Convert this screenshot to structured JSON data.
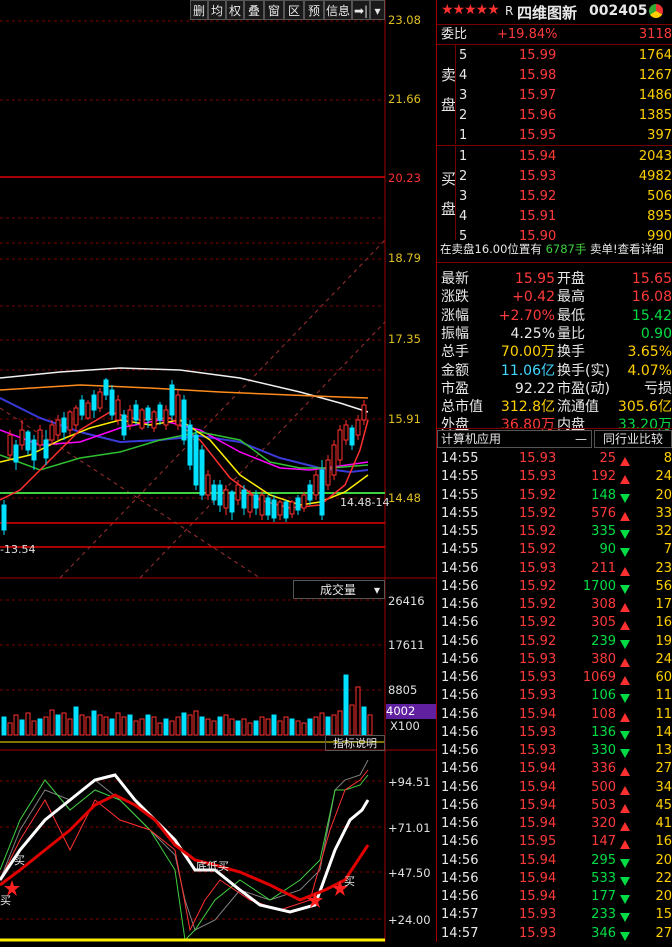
{
  "toolbar": {
    "buttons": [
      "删",
      "均",
      "权",
      "叠",
      "窗",
      "区",
      "预",
      "信息",
      "➡|",
      "▾"
    ]
  },
  "price_axis": [
    "23.08",
    "21.66",
    "20.23",
    "18.79",
    "17.35",
    "15.91",
    "14.48"
  ],
  "low_label": "13.54",
  "low_marker": "14.48-14",
  "volume": {
    "label": "成交量",
    "axis": [
      "26416",
      "17611",
      "8805"
    ],
    "current": "4002",
    "unit": "X100"
  },
  "indicator": {
    "label": "指标说明",
    "axis": [
      "+94.51",
      "+71.01",
      "+47.50",
      "+24.00"
    ],
    "annotations": [
      "买",
      "买",
      "底低买",
      "买"
    ]
  },
  "stock": {
    "rating_stars": 5,
    "prefix": "R",
    "name": "四维图新",
    "code": "002405"
  },
  "order_book": {
    "commission_ratio_label": "委比",
    "commission_ratio": "+19.84%",
    "commission_diff": "3118",
    "sell_label": [
      "卖",
      "盘"
    ],
    "buy_label": [
      "买",
      "盘"
    ],
    "sells": [
      {
        "level": "5",
        "price": "15.99",
        "vol": "1764"
      },
      {
        "level": "4",
        "price": "15.98",
        "vol": "1267"
      },
      {
        "level": "3",
        "price": "15.97",
        "vol": "1486"
      },
      {
        "level": "2",
        "price": "15.96",
        "vol": "1385"
      },
      {
        "level": "1",
        "price": "15.95",
        "vol": "397"
      }
    ],
    "buys": [
      {
        "level": "1",
        "price": "15.94",
        "vol": "2043"
      },
      {
        "level": "2",
        "price": "15.93",
        "vol": "4982"
      },
      {
        "level": "3",
        "price": "15.92",
        "vol": "506"
      },
      {
        "level": "4",
        "price": "15.91",
        "vol": "895"
      },
      {
        "level": "5",
        "price": "15.90",
        "vol": "990"
      }
    ],
    "notice_prefix": "在卖盘16.00位置有",
    "notice_vol": "6787手",
    "notice_suffix": "卖单!查看详细"
  },
  "quote": [
    {
      "l1": "最新",
      "v1": "15.95",
      "l2": "开盘",
      "v2": "15.65",
      "c1": "red",
      "c2": "red"
    },
    {
      "l1": "涨跌",
      "v1": "+0.42",
      "l2": "最高",
      "v2": "16.08",
      "c1": "red",
      "c2": "red"
    },
    {
      "l1": "涨幅",
      "v1": "+2.70%",
      "l2": "最低",
      "v2": "15.42",
      "c1": "red",
      "c2": "grn"
    },
    {
      "l1": "振幅",
      "v1": "4.25%",
      "l2": "量比",
      "v2": "0.90",
      "c1": "wht",
      "c2": "grn"
    },
    {
      "l1": "总手",
      "v1": "70.00万",
      "l2": "换手",
      "v2": "3.65%",
      "c1": "yel",
      "c2": "yel"
    },
    {
      "l1": "金额",
      "v1": "11.06亿",
      "l2": "换手(实)",
      "v2": "4.07%",
      "c1": "cyn",
      "c2": "yel"
    },
    {
      "l1": "市盈",
      "v1": "92.22",
      "l2": "市盈(动)",
      "v2": "亏损",
      "c1": "wht",
      "c2": "wht"
    },
    {
      "l1": "总市值",
      "v1": "312.8亿",
      "l2": "流通值",
      "v2": "305.6亿",
      "c1": "yel",
      "c2": "yel"
    },
    {
      "l1": "外盘",
      "v1": "36.80万",
      "l2": "内盘",
      "v2": "33.20万",
      "c1": "red",
      "c2": "grn"
    }
  ],
  "tabs": {
    "left": "计算机应用",
    "left_icon": "—",
    "right": "同行业比较"
  },
  "ticks": [
    {
      "time": "14:55",
      "price": "15.93",
      "vol": "25",
      "dir": "up",
      "extra": "8"
    },
    {
      "time": "14:55",
      "price": "15.93",
      "vol": "192",
      "dir": "up",
      "extra": "24"
    },
    {
      "time": "14:55",
      "price": "15.92",
      "vol": "148",
      "dir": "dn",
      "extra": "20"
    },
    {
      "time": "14:55",
      "price": "15.92",
      "vol": "576",
      "dir": "up",
      "extra": "33"
    },
    {
      "time": "14:55",
      "price": "15.92",
      "vol": "335",
      "dir": "dn",
      "extra": "32"
    },
    {
      "time": "14:55",
      "price": "15.92",
      "vol": "90",
      "dir": "dn",
      "extra": "7"
    },
    {
      "time": "14:56",
      "price": "15.93",
      "vol": "211",
      "dir": "up",
      "extra": "23"
    },
    {
      "time": "14:56",
      "price": "15.92",
      "vol": "1700",
      "dir": "dn",
      "extra": "56"
    },
    {
      "time": "14:56",
      "price": "15.92",
      "vol": "308",
      "dir": "up",
      "extra": "17"
    },
    {
      "time": "14:56",
      "price": "15.92",
      "vol": "305",
      "dir": "up",
      "extra": "16"
    },
    {
      "time": "14:56",
      "price": "15.92",
      "vol": "239",
      "dir": "dn",
      "extra": "19"
    },
    {
      "time": "14:56",
      "price": "15.93",
      "vol": "380",
      "dir": "up",
      "extra": "24"
    },
    {
      "time": "14:56",
      "price": "15.93",
      "vol": "1069",
      "dir": "up",
      "extra": "60"
    },
    {
      "time": "14:56",
      "price": "15.93",
      "vol": "106",
      "dir": "dn",
      "extra": "11"
    },
    {
      "time": "14:56",
      "price": "15.94",
      "vol": "108",
      "dir": "up",
      "extra": "11"
    },
    {
      "time": "14:56",
      "price": "15.93",
      "vol": "136",
      "dir": "dn",
      "extra": "14"
    },
    {
      "time": "14:56",
      "price": "15.93",
      "vol": "330",
      "dir": "dn",
      "extra": "13"
    },
    {
      "time": "14:56",
      "price": "15.94",
      "vol": "336",
      "dir": "up",
      "extra": "27"
    },
    {
      "time": "14:56",
      "price": "15.94",
      "vol": "500",
      "dir": "up",
      "extra": "34"
    },
    {
      "time": "14:56",
      "price": "15.94",
      "vol": "503",
      "dir": "up",
      "extra": "45"
    },
    {
      "time": "14:56",
      "price": "15.94",
      "vol": "320",
      "dir": "up",
      "extra": "41"
    },
    {
      "time": "14:56",
      "price": "15.95",
      "vol": "147",
      "dir": "up",
      "extra": "16"
    },
    {
      "time": "14:56",
      "price": "15.94",
      "vol": "295",
      "dir": "dn",
      "extra": "20"
    },
    {
      "time": "14:56",
      "price": "15.94",
      "vol": "533",
      "dir": "dn",
      "extra": "22"
    },
    {
      "time": "14:56",
      "price": "15.94",
      "vol": "177",
      "dir": "dn",
      "extra": "20"
    },
    {
      "time": "14:57",
      "price": "15.93",
      "vol": "233",
      "dir": "dn",
      "extra": "15"
    },
    {
      "time": "14:57",
      "price": "15.93",
      "vol": "346",
      "dir": "dn",
      "extra": "27"
    }
  ]
}
